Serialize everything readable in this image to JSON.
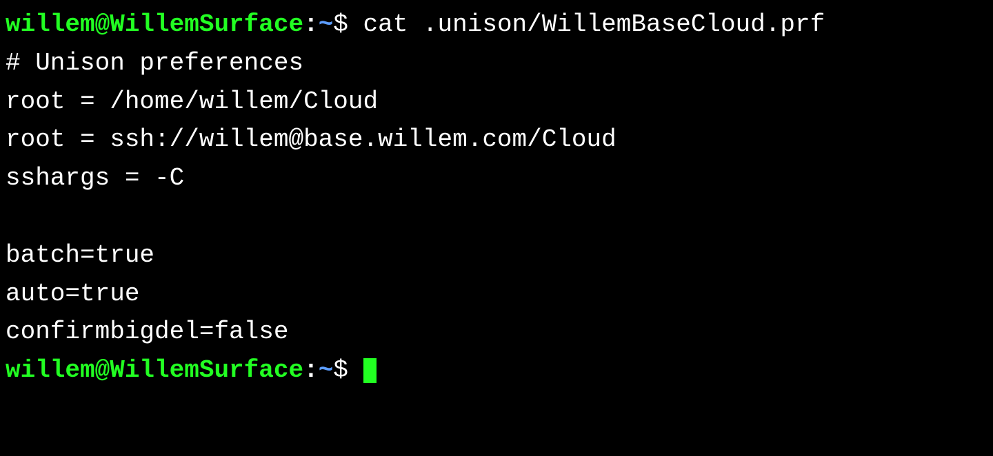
{
  "colors": {
    "background": "#000000",
    "foreground": "#ffffff",
    "user_host": "#22ff22",
    "path": "#5c9dff",
    "cursor": "#22ff22"
  },
  "prompt1": {
    "user_host": "willem@WillemSurface",
    "colon": ":",
    "path": "~",
    "symbol": "$ ",
    "command": "cat .unison/WillemBaseCloud.prf"
  },
  "output": {
    "line1": "# Unison preferences",
    "line2": "root = /home/willem/Cloud",
    "line3": "root = ssh://willem@base.willem.com/Cloud",
    "line4": "sshargs = -C",
    "line5": " ",
    "line6": "batch=true",
    "line7": "auto=true",
    "line8": "confirmbigdel=false"
  },
  "prompt2": {
    "user_host": "willem@WillemSurface",
    "colon": ":",
    "path": "~",
    "symbol": "$ "
  }
}
